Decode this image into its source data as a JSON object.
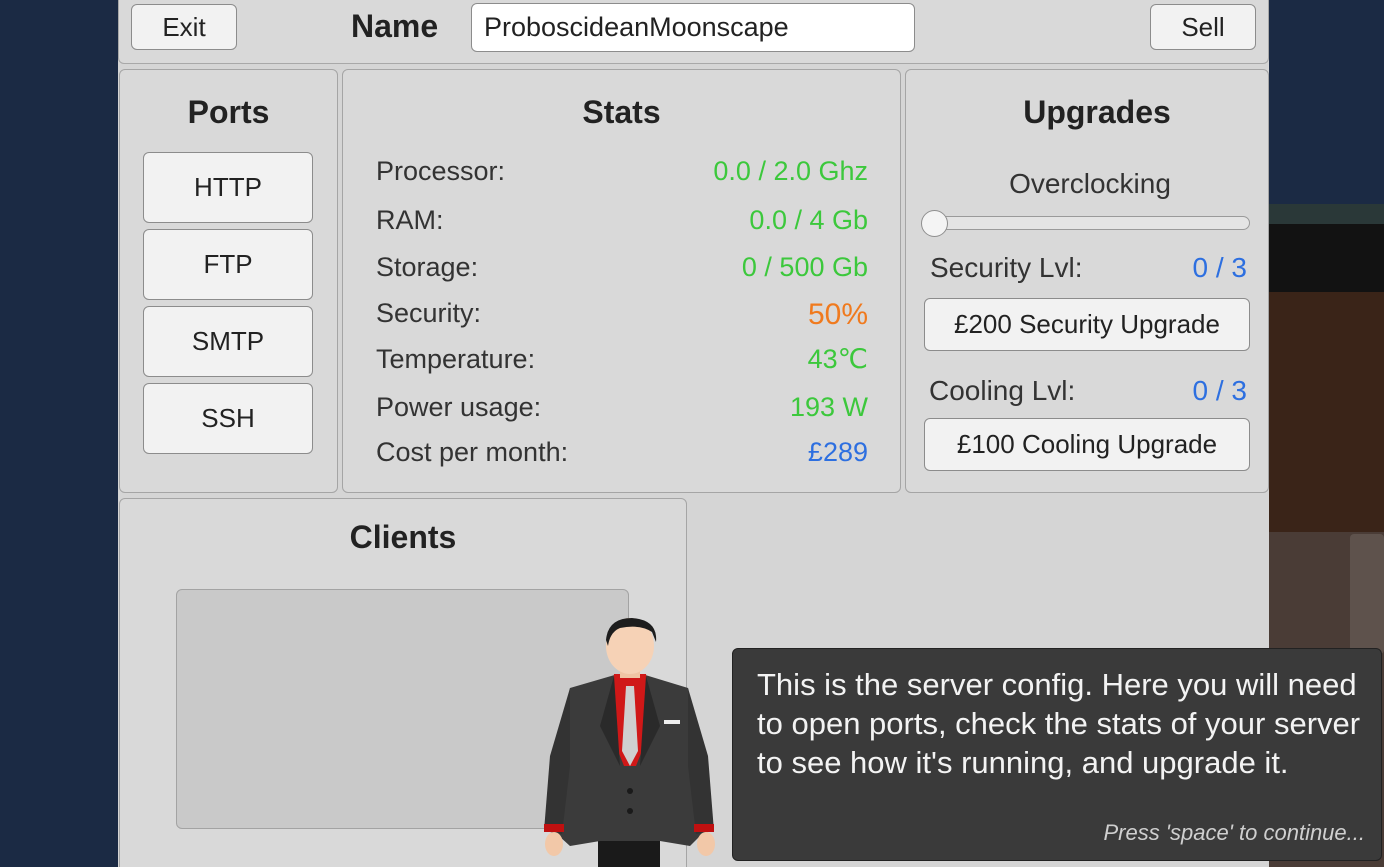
{
  "header": {
    "exit_label": "Exit",
    "name_label": "Name",
    "name_value": "ProboscideanMoonscape",
    "sell_label": "Sell"
  },
  "ports": {
    "title": "Ports",
    "buttons": [
      "HTTP",
      "FTP",
      "SMTP",
      "SSH"
    ]
  },
  "stats": {
    "title": "Stats",
    "rows": [
      {
        "label": "Processor:",
        "value": "0.0 / 2.0 Ghz",
        "color": "#3cc83c"
      },
      {
        "label": "RAM:",
        "value": "0.0 / 4 Gb",
        "color": "#3cc83c"
      },
      {
        "label": "Storage:",
        "value": "0 / 500 Gb",
        "color": "#3cc83c"
      },
      {
        "label": "Security:",
        "value": "50%",
        "color": "#f07a1e"
      },
      {
        "label": "Temperature:",
        "value": "43℃",
        "color": "#3cc83c"
      },
      {
        "label": "Power usage:",
        "value": "193 W",
        "color": "#3cc83c"
      },
      {
        "label": "Cost per month:",
        "value": "£289",
        "color": "#2d6fe0"
      }
    ]
  },
  "upgrades": {
    "title": "Upgrades",
    "overclocking_label": "Overclocking",
    "overclocking_level": 0,
    "security_label": "Security Lvl:",
    "security_value": "0 / 3",
    "security_button": "£200 Security Upgrade",
    "cooling_label": "Cooling Lvl:",
    "cooling_value": "0 / 3",
    "cooling_button": "£100 Cooling Upgrade"
  },
  "clients": {
    "title": "Clients"
  },
  "dialog": {
    "text": "This is the server config. Here you will need to open ports, check the stats of your server to see how it's running, and upgrade it.",
    "hint": "Press 'space' to continue..."
  },
  "colors": {
    "good": "#3cc83c",
    "warning": "#f07a1e",
    "info": "#2d6fe0"
  }
}
